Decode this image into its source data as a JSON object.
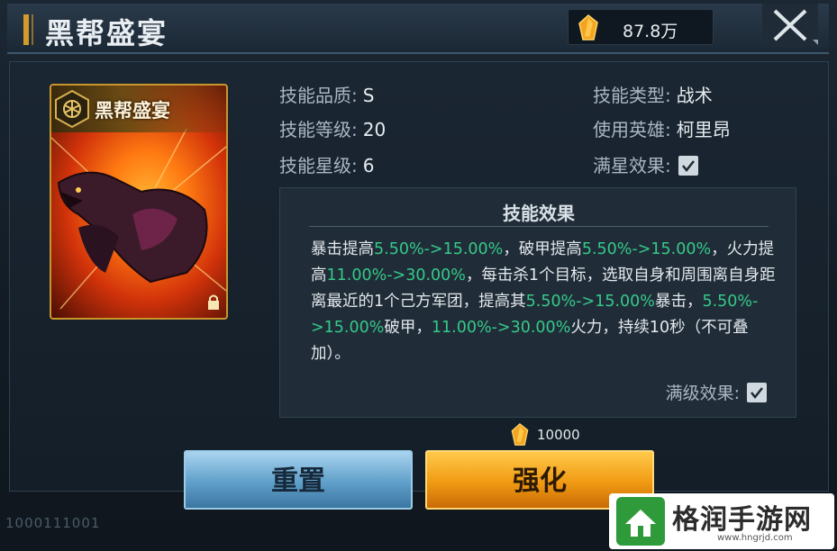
{
  "window": {
    "title": "黑帮盛宴"
  },
  "currency": {
    "icon": "crystal-icon",
    "amount": "87.8万"
  },
  "card": {
    "name": "黑帮盛宴",
    "frame_color": "#c9962e"
  },
  "info": {
    "quality_label": "技能品质:",
    "quality_value": "S",
    "level_label": "技能等级:",
    "level_value": "20",
    "star_label": "技能星级:",
    "star_value": "6",
    "type_label": "技能类型:",
    "type_value": "战术",
    "hero_label": "使用英雄:",
    "hero_value": "柯里昂",
    "fullstar_label": "满星效果:",
    "fullstar_checked": true
  },
  "effect": {
    "title": "技能效果",
    "segments": [
      {
        "t": "暴击提高",
        "g": false
      },
      {
        "t": "5.50%->15.00%",
        "g": true
      },
      {
        "t": "，破甲提高",
        "g": false
      },
      {
        "t": "5.50%->15.00%",
        "g": true
      },
      {
        "t": "，火力提高",
        "g": false
      },
      {
        "t": "11.00%->30.00%",
        "g": true
      },
      {
        "t": "，每击杀1个目标，选取自身和周围离自身距离最近的1个己方军团，提高其",
        "g": false
      },
      {
        "t": "5.50%->15.00%",
        "g": true
      },
      {
        "t": "暴击，",
        "g": false
      },
      {
        "t": "5.50%->15.00%",
        "g": true
      },
      {
        "t": "破甲，",
        "g": false
      },
      {
        "t": "11.00%->30.00%",
        "g": true
      },
      {
        "t": "火力，持续10秒（不可叠加）。",
        "g": false
      }
    ],
    "maxlevel_label": "满级效果:",
    "maxlevel_checked": true
  },
  "cost": {
    "amount": "10000"
  },
  "buttons": {
    "reset": "重置",
    "upgrade": "强化"
  },
  "footer_id": "1000111001",
  "watermark": {
    "text": "格润手游网",
    "url": "www.hngrjd.com"
  },
  "colors": {
    "accent_green": "#35c98a",
    "gold": "#f09a13",
    "blue": "#5f9fc9"
  }
}
